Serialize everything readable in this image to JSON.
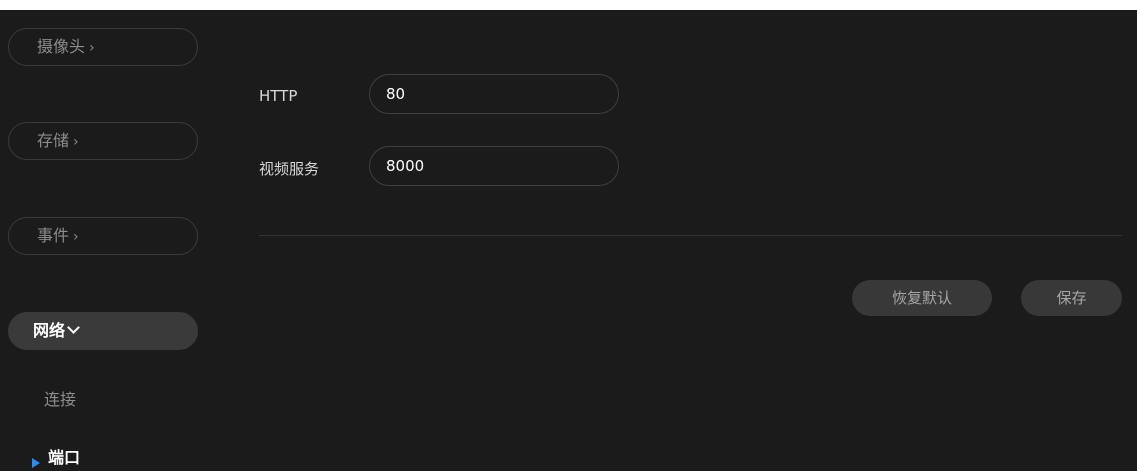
{
  "sidebar": {
    "items": [
      {
        "label": "摄像头",
        "chevron": "›"
      },
      {
        "label": "存储",
        "chevron": "›"
      },
      {
        "label": "事件",
        "chevron": "›"
      },
      {
        "label": "网络",
        "chevron": "expanded"
      }
    ],
    "sub_items": [
      {
        "label": "连接"
      },
      {
        "label": "端口"
      }
    ]
  },
  "form": {
    "http": {
      "label": "HTTP",
      "value": "80"
    },
    "video_service": {
      "label": "视频服务",
      "value": "8000"
    }
  },
  "buttons": {
    "restore_default": "恢复默认",
    "save": "保存"
  },
  "colors": {
    "background": "#1b1b1b",
    "active_marker": "#2f8bf0"
  }
}
